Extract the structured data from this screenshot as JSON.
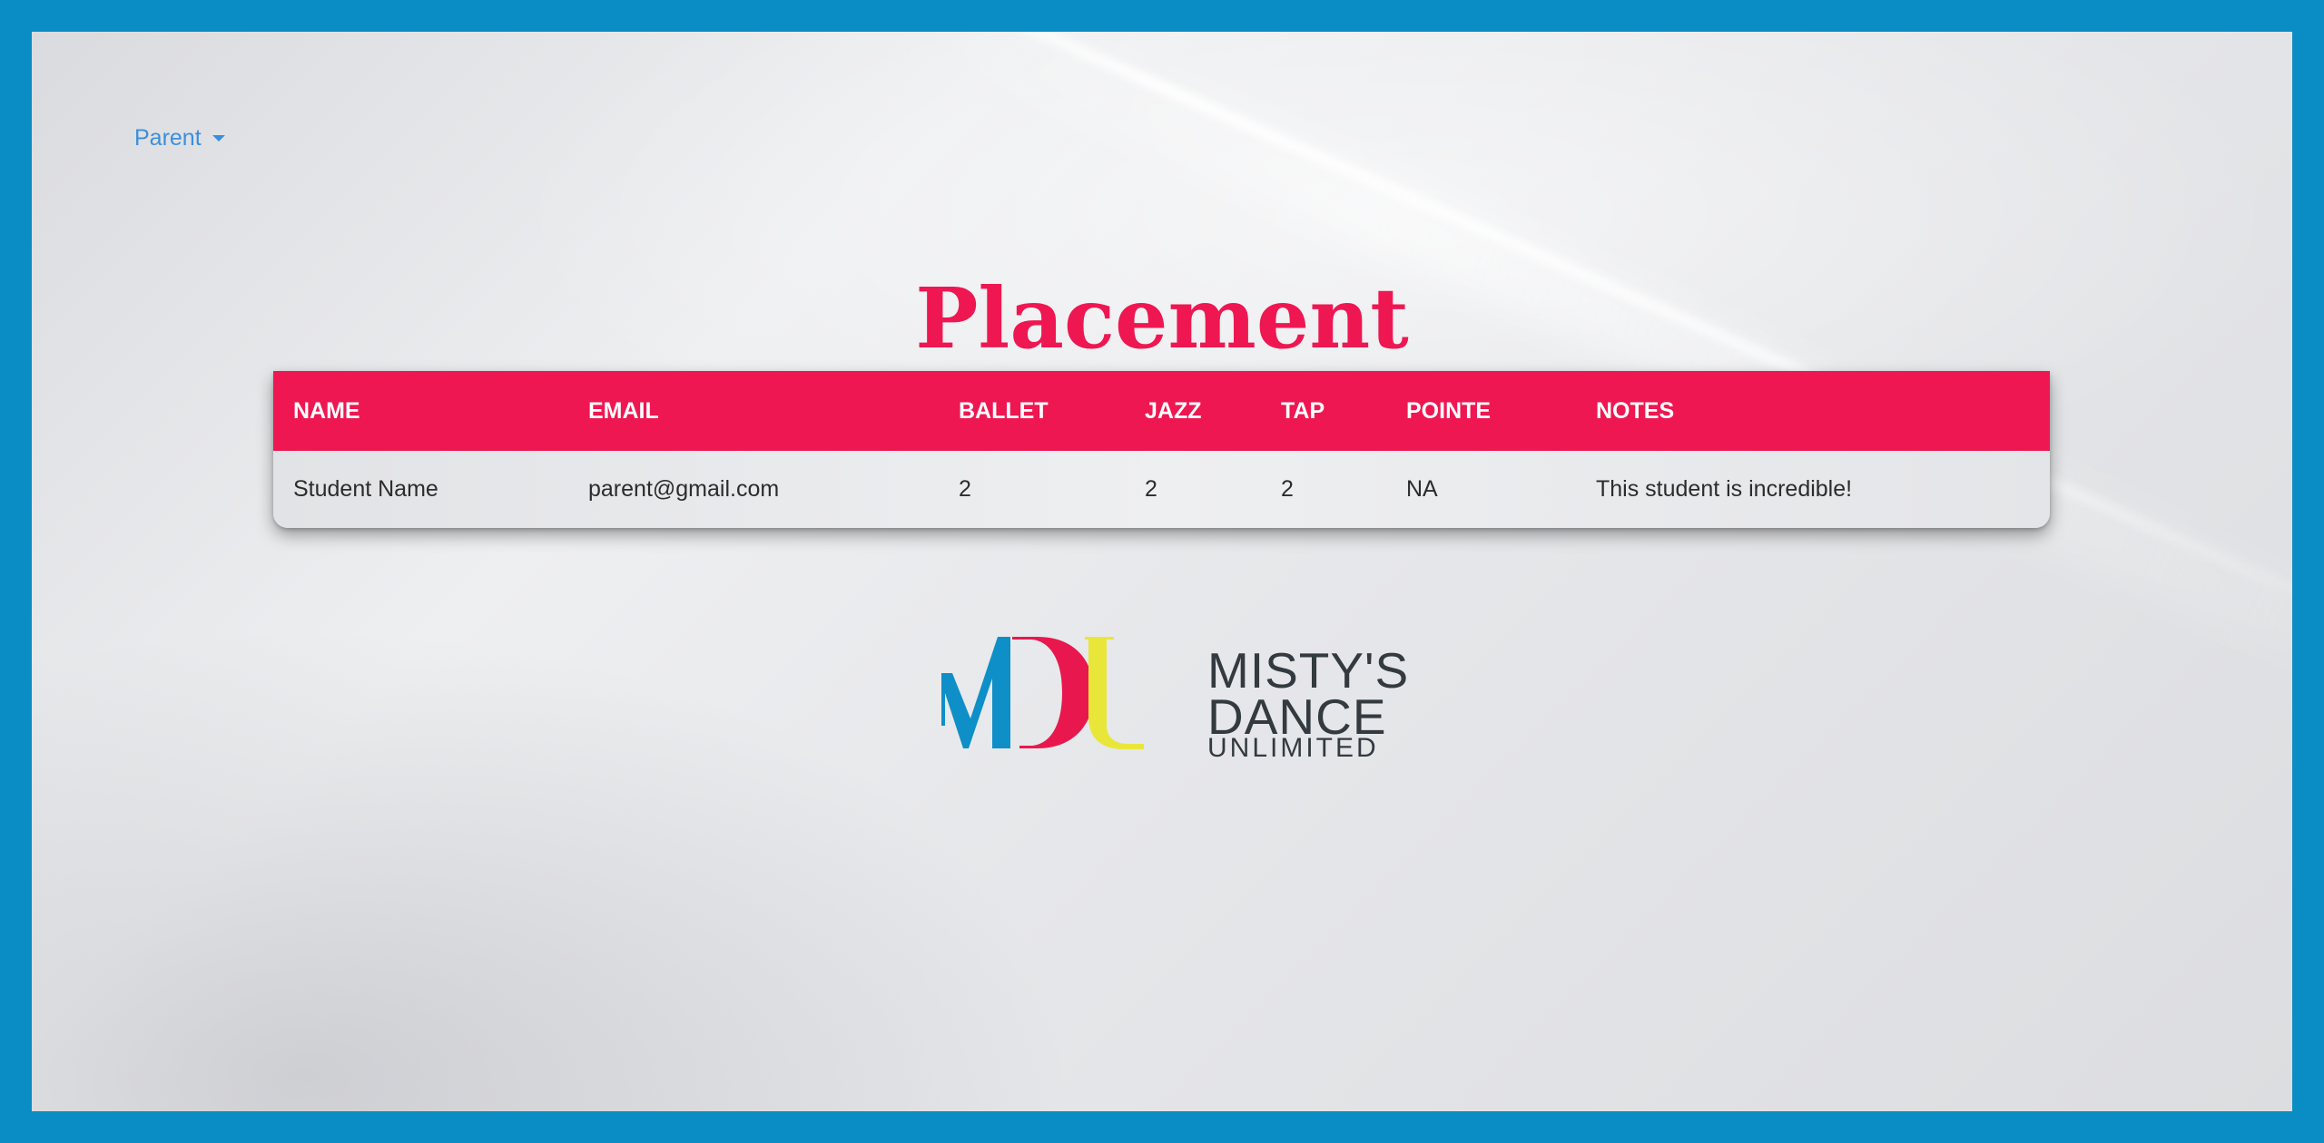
{
  "nav": {
    "user_menu_label": "Parent"
  },
  "page": {
    "title": "Placement"
  },
  "table": {
    "columns": [
      "NAME",
      "EMAIL",
      "BALLET",
      "JAZZ",
      "TAP",
      "POINTE",
      "NOTES"
    ],
    "rows": [
      [
        "Student Name",
        "parent@gmail.com",
        "2",
        "2",
        "2",
        "NA",
        "This student is incredible!"
      ]
    ]
  },
  "logo": {
    "line1": "MISTY'S",
    "line2": "DANCE",
    "line3": "UNLIMITED"
  },
  "colors": {
    "frame": "#0a8dc4",
    "accent": "#ee1751",
    "link": "#3a8fdc",
    "logo_blue": "#0e8fc8",
    "logo_pink": "#e8184e",
    "logo_yellow": "#e9e63a",
    "logo_text": "#333a40"
  }
}
